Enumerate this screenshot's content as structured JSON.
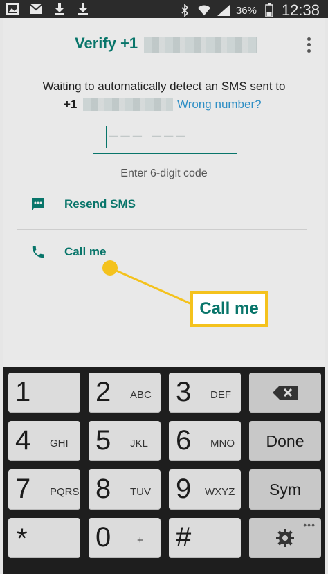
{
  "status_bar": {
    "battery": "36%",
    "time": "12:38",
    "left_icons": [
      "image-icon",
      "mail-icon",
      "download-icon",
      "download-icon"
    ],
    "right_icons": [
      "bluetooth-icon",
      "wifi-icon",
      "signal-icon",
      "battery-icon"
    ]
  },
  "header": {
    "title": "Verify +1"
  },
  "verify": {
    "wait_text": "Waiting to automatically detect an SMS sent to",
    "number_prefix": "+1",
    "wrong_number": "Wrong number?",
    "code_placeholder": "––– –––",
    "hint": "Enter 6-digit code"
  },
  "actions": {
    "resend": "Resend SMS",
    "call": "Call me"
  },
  "callout": {
    "label": "Call me",
    "color": "#f4c21d"
  },
  "keypad": {
    "keys": [
      {
        "num": "1",
        "sub": ""
      },
      {
        "num": "2",
        "sub": "ABC"
      },
      {
        "num": "3",
        "sub": "DEF"
      },
      {
        "num": "4",
        "sub": "GHI"
      },
      {
        "num": "5",
        "sub": "JKL"
      },
      {
        "num": "6",
        "sub": "MNO"
      },
      {
        "num": "7",
        "sub": "PQRS"
      },
      {
        "num": "8",
        "sub": "TUV"
      },
      {
        "num": "9",
        "sub": "WXYZ"
      },
      {
        "num": "*",
        "sub": ""
      },
      {
        "num": "0",
        "sub": "+"
      },
      {
        "num": "#",
        "sub": ""
      }
    ],
    "done": "Done",
    "sym": "Sym"
  },
  "colors": {
    "accent": "#08756a",
    "link": "#2f8fc5"
  }
}
